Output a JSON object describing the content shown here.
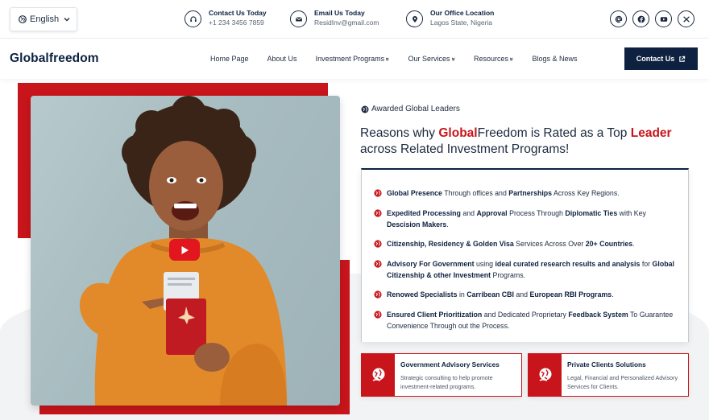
{
  "topbar": {
    "language": "English",
    "contacts": [
      {
        "title": "Contact Us Today",
        "value": "+1 234 3456 7859",
        "icon": "headset-icon"
      },
      {
        "title": "Email Us Today",
        "value": "ResidInv@gmail.com",
        "icon": "mail-icon"
      },
      {
        "title": "Our Office Location",
        "value": "Lagos State, Nigeria",
        "icon": "location-pin-icon"
      }
    ],
    "socials": [
      "threads-icon",
      "facebook-icon",
      "youtube-icon",
      "x-icon"
    ]
  },
  "nav": {
    "logo": "Globalfreedom",
    "items": [
      "Home Page",
      "About Us",
      "Investment Programs",
      "Our Services",
      "Resources",
      "Blogs & News"
    ],
    "dropdown_marker": "»",
    "cta": "Contact Us"
  },
  "hero": {
    "award_label": "Awarded Global Leaders",
    "headline": {
      "pre": "Reasons why ",
      "brand_a": "Global",
      "brand_b": "Freedom",
      "mid": " is Rated as a Top ",
      "accent": "Leader",
      "post": "across Related Investment Programs!"
    },
    "features": [
      {
        "b1": "Global Presence",
        "t1": " Through offices and ",
        "b2": "Partnerships",
        "t2": " Across Key Regions."
      },
      {
        "b1": "Expedited Processing",
        "t1": " and ",
        "b2": "Approval",
        "t2": " Process Through ",
        "b3": "Diplomatic Ties",
        "t3": " with Key ",
        "b4": "Descision Makers",
        "t4": "."
      },
      {
        "b1": "Citizenship, Residency & Golden Visa",
        "t1": " Services Across Over ",
        "b2": "20+ Countries",
        "t2": "."
      },
      {
        "b1": "Advisory For Government",
        "t1": " using ",
        "b2": "ideal curated research results and analysis",
        "t2": " for ",
        "b3": "Global Citizenship & other Investment",
        "t3": " Programs."
      },
      {
        "b1": "Renowed Specialists",
        "t1": " in ",
        "b2": "Carribean CBI",
        "t2": " and ",
        "b3": "European RBI Programs",
        "t3": "."
      },
      {
        "b1": "Ensured Client Prioritization",
        "t1": " and Dedicated Proprietary ",
        "b2": "Feedback System",
        "t2": " To Guarantee Convenience Through out the Process."
      }
    ],
    "services": [
      {
        "title": "Government Advisory Services",
        "desc": "Strategic consulting to help promote investment-related programs."
      },
      {
        "title": "Private Clients Solutions",
        "desc": "Legal, Financial and Personalized Advisory Services for Clients."
      }
    ]
  },
  "colors": {
    "navy": "#0e2140",
    "red": "#c8151b",
    "youtube": "#e1161e"
  }
}
